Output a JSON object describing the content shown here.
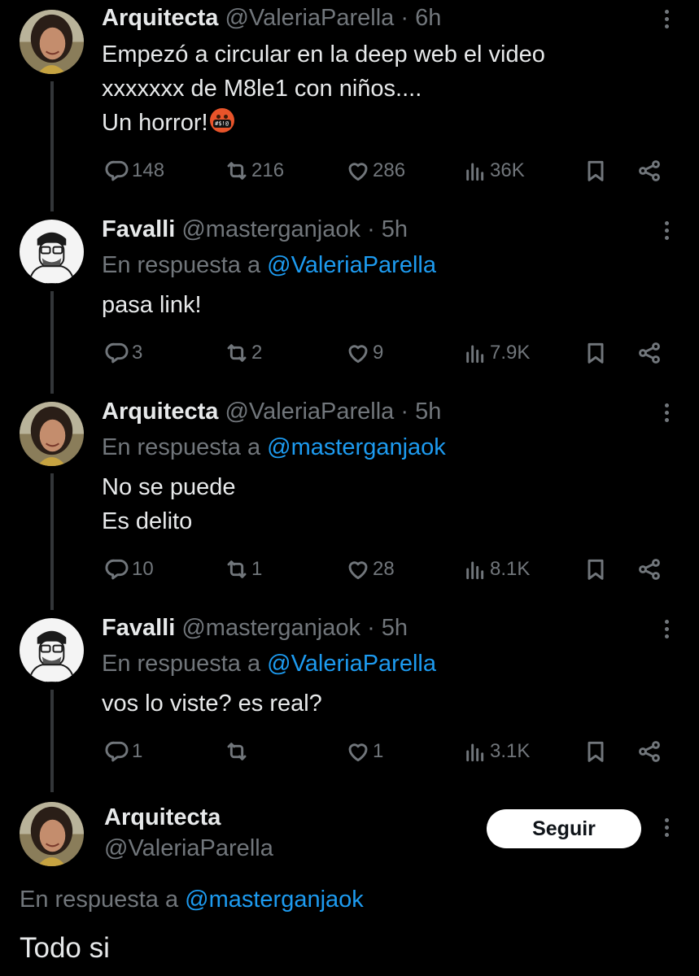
{
  "colors": {
    "background": "#000000",
    "text": "#e7e9ea",
    "muted": "#71767b",
    "link": "#1d9bf0",
    "follow_button": "#ffffff"
  },
  "reply_prefix": "En respuesta a",
  "tweets": [
    {
      "name": "Arquitecta",
      "handle": "@ValeriaParella",
      "time": "· 6h",
      "reply_to": "",
      "lines": [
        "Empezó a circular en la deep web el video",
        "xxxxxxx de M8le1 con niños....",
        "Un horror!"
      ],
      "emoji": "face-with-symbols-on-mouth",
      "emoji_text": "#$!@",
      "replies": "148",
      "retweets": "216",
      "likes": "286",
      "views": "36K"
    },
    {
      "name": "Favalli",
      "handle": "@masterganjaok",
      "time": "· 5h",
      "reply_to": "@ValeriaParella",
      "lines": [
        "pasa link!"
      ],
      "replies": "3",
      "retweets": "2",
      "likes": "9",
      "views": "7.9K"
    },
    {
      "name": "Arquitecta",
      "handle": "@ValeriaParella",
      "time": "· 5h",
      "reply_to": "@masterganjaok",
      "lines": [
        "No se puede",
        "Es delito"
      ],
      "replies": "10",
      "retweets": "1",
      "likes": "28",
      "views": "8.1K"
    },
    {
      "name": "Favalli",
      "handle": "@masterganjaok",
      "time": "· 5h",
      "reply_to": "@ValeriaParella",
      "lines": [
        "vos lo viste? es real?"
      ],
      "replies": "1",
      "retweets": "",
      "likes": "1",
      "views": "3.1K"
    }
  ],
  "main_tweet": {
    "name": "Arquitecta",
    "handle": "@ValeriaParella",
    "follow_label": "Seguir",
    "reply_to": "@masterganjaok",
    "text": "Todo si"
  },
  "icons": [
    "reply-icon",
    "retweet-icon",
    "like-icon",
    "views-icon",
    "bookmark-icon",
    "share-icon",
    "more-icon"
  ]
}
